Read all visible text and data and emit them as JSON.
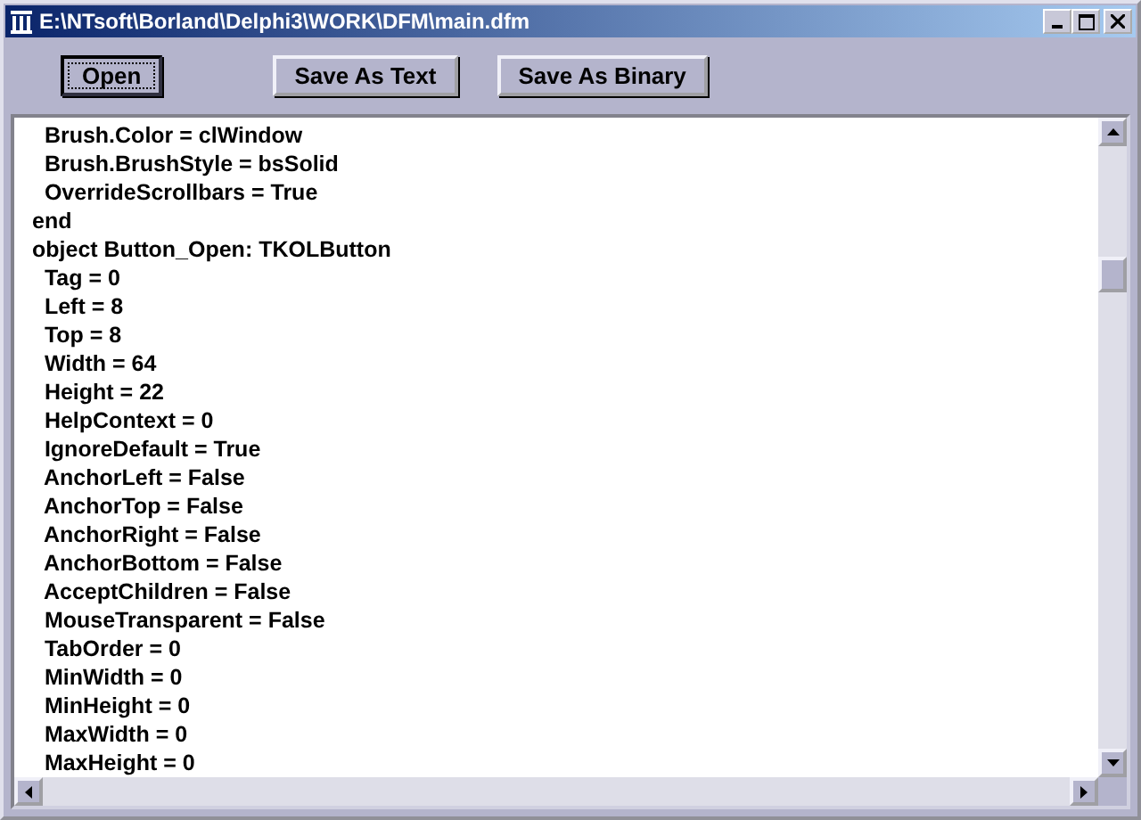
{
  "window": {
    "title": "E:\\NTsoft\\Borland\\Delphi3\\WORK\\DFM\\main.dfm"
  },
  "toolbar": {
    "buttons": [
      {
        "label": "Open",
        "focused": true
      },
      {
        "label": "Save As Text",
        "focused": false
      },
      {
        "label": "Save As Binary",
        "focused": false
      }
    ]
  },
  "editor": {
    "lines": [
      "  Brush.Color = clWindow",
      "  Brush.BrushStyle = bsSolid",
      "  OverrideScrollbars = True",
      "end",
      "object Button_Open: TKOLButton",
      "  Tag = 0",
      "  Left = 8",
      "  Top = 8",
      "  Width = 64",
      "  Height = 22",
      "  HelpContext = 0",
      "  IgnoreDefault = True",
      "  AnchorLeft = False",
      "  AnchorTop = False",
      "  AnchorRight = False",
      "  AnchorBottom = False",
      "  AcceptChildren = False",
      "  MouseTransparent = False",
      "  TabOrder = 0",
      "  MinWidth = 0",
      "  MinHeight = 0",
      "  MaxWidth = 0",
      "  MaxHeight = 0"
    ]
  }
}
